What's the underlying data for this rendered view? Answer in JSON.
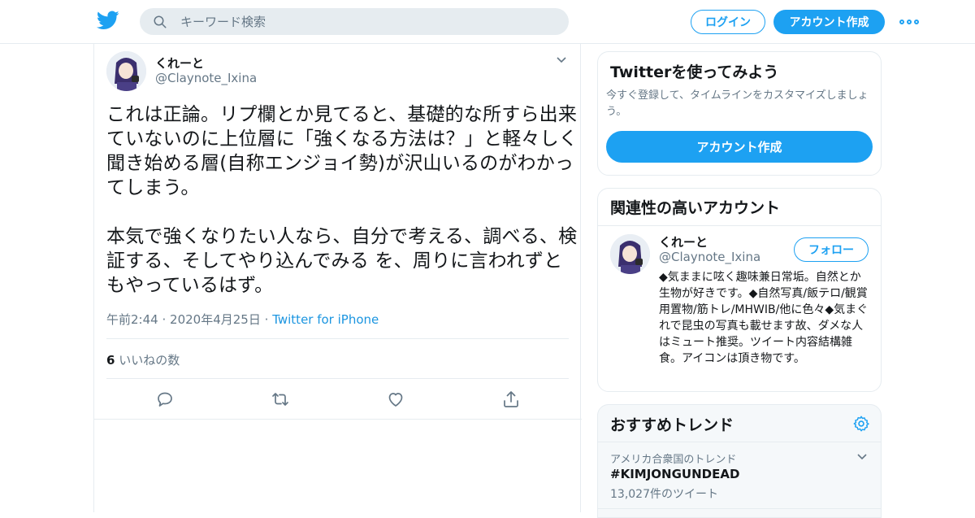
{
  "header": {
    "search_placeholder": "キーワード検索",
    "login_label": "ログイン",
    "signup_label": "アカウント作成"
  },
  "tweet": {
    "author_name": "くれーと",
    "author_handle": "@Claynote_Ixina",
    "text": "これは正論。リプ欄とか見てると、基礎的な所すら出来ていないのに上位層に「強くなる方法は？」と軽々しく聞き始める層(自称エンジョイ勢)が沢山いるのがわかってしまう。\n\n本気で強くなりたい人なら、自分で考える、調べる、検証する、そしてやり込んでみる を、周りに言われずともやっているはず。",
    "time": "午前2:44",
    "date": "2020年4月25日",
    "separator": "·",
    "client": "Twitter for iPhone",
    "like_count": "6",
    "like_label": "いいねの数"
  },
  "signup_card": {
    "title": "Twitterを使ってみよう",
    "description": "今すぐ登録して、タイムラインをカスタマイズしましょう。",
    "button_label": "アカウント作成"
  },
  "related_card": {
    "title": "関連性の高いアカウント",
    "account": {
      "name": "くれーと",
      "handle": "@Claynote_Ixina",
      "follow_label": "フォロー",
      "bio": "◆気ままに呟く趣味兼日常垢。自然とか生物が好きです。◆自然写真/飯テロ/観賞用置物/筋トレ/MHWIB/他に色々◆気まぐれで昆虫の写真も載せます故、ダメな人はミュート推奨。ツイート内容結構雑食。アイコンは頂き物です。"
    }
  },
  "trends_card": {
    "title": "おすすめトレンド",
    "items": [
      {
        "context": "アメリカ合衆国のトレンド",
        "name": "#KIMJONGUNDEAD",
        "count": "13,027件のツイート"
      }
    ]
  },
  "colors": {
    "accent": "#1da1f2",
    "muted": "#657786",
    "border": "#e6ecf0"
  }
}
